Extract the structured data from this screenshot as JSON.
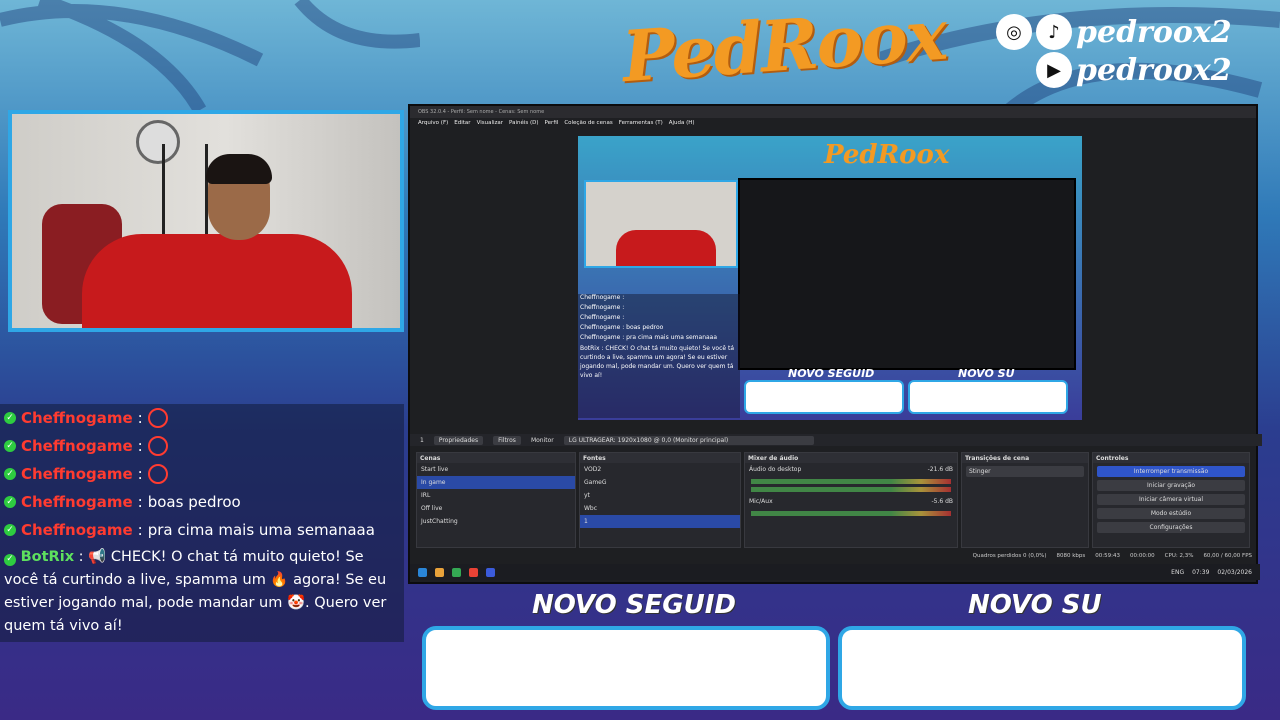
{
  "brand": {
    "logo": "PedRoox",
    "social_handle_1": "pedroox2",
    "social_handle_2": "pedroox2"
  },
  "chat": {
    "messages": [
      {
        "user": "Cheffnogame",
        "sep": ":",
        "text": ""
      },
      {
        "user": "Cheffnogame",
        "sep": ":",
        "text": ""
      },
      {
        "user": "Cheffnogame",
        "sep": ":",
        "text": ""
      },
      {
        "user": "Cheffnogame",
        "sep": ":",
        "text": "boas pedroo"
      },
      {
        "user": "Cheffnogame",
        "sep": ":",
        "text": "pra cima mais uma semanaaa"
      }
    ],
    "bot": {
      "user": "BotRix",
      "sep": ":",
      "text": "CHECK! O chat tá muito quieto! Se você tá curtindo a live, spamma um 🔥 agora! Se eu estiver jogando mal, pode mandar um 🤡. Quero ver quem tá vivo aí!"
    }
  },
  "obs": {
    "title": "OBS 32.0.4 - Perfil: Sem nome - Cenas: Sem nome",
    "menu": [
      "Arquivo (F)",
      "Editar",
      "Visualizar",
      "Painéis (D)",
      "Perfil",
      "Coleção de cenas",
      "Ferramentas (T)",
      "Ajuda (H)"
    ],
    "source_bar": {
      "selected": "1",
      "properties": "Propriedades",
      "filters": "Filtros",
      "monitor_label": "Monitor",
      "monitor_value": "LG ULTRAGEAR: 1920x1080 @ 0,0 (Monitor principal)"
    },
    "scenes": {
      "title": "Cenas",
      "items": [
        "Start live",
        "In game",
        "IRL",
        "Off live",
        "JustChatting"
      ],
      "selected": 1
    },
    "sources": {
      "title": "Fontes",
      "items": [
        "VOD2",
        "GameG",
        "yt",
        "Wbc",
        "1"
      ],
      "selected": 4
    },
    "mixer": {
      "title": "Mixer de áudio",
      "ch1": "Áudio do desktop",
      "ch1_db": "-21.6 dB",
      "ch2": "Mic/Aux",
      "ch2_db": "-5.6 dB"
    },
    "transitions": {
      "title": "Transições de cena",
      "value": "Stinger"
    },
    "controls": {
      "title": "Controles",
      "buttons": [
        "Interromper transmissão",
        "Iniciar gravação",
        "Iniciar câmera virtual",
        "Modo estúdio",
        "Configurações"
      ]
    },
    "status": {
      "frames": "Quadros perdidos 0 (0,0%)",
      "bitrate": "8080 kbps",
      "live": "00:59:43",
      "rec": "00:00:00",
      "cpu": "CPU: 2,3%",
      "fps": "60,00 / 60,00 FPS"
    },
    "preview_chat": [
      "Cheffnogame :",
      "Cheffnogame :",
      "Cheffnogame :",
      "Cheffnogame : boas pedroo",
      "Cheffnogame : pra cima mais uma semanaaa",
      "BotRix : CHECK! O chat tá muito quieto! Se você tá curtindo a live, spamma um agora! Se eu estiver jogando mal, pode mandar um. Quero ver quem tá vivo aí!"
    ],
    "taskbar": {
      "lang": "ENG",
      "time": "07:39",
      "date": "02/03/2026"
    }
  },
  "followers": {
    "label_1": "NOVO SEGUID",
    "label_2": "NOVO SU"
  }
}
